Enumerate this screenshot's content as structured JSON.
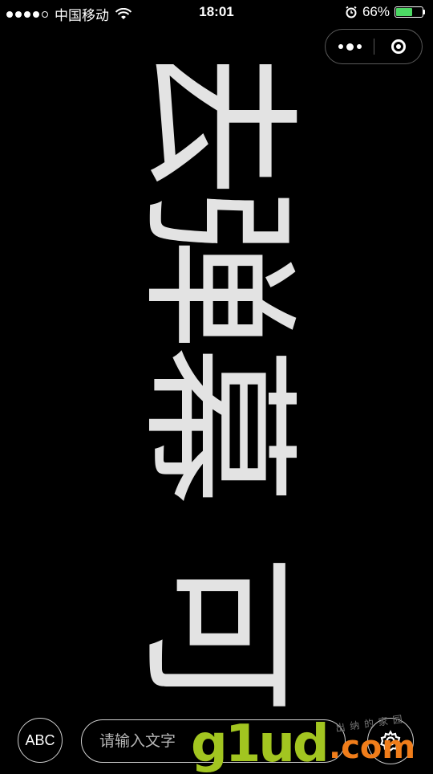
{
  "status_bar": {
    "carrier": "中国移动",
    "time": "18:01",
    "battery_percent": "66%",
    "battery_level": 0.66,
    "battery_color": "#4cd964"
  },
  "capsule": {
    "menu_icon": "more-dots-icon",
    "close_icon": "target-circle-icon"
  },
  "danmaku": {
    "chars": [
      "去",
      "弹",
      "幕",
      "可"
    ],
    "text_color": "#e3e3e3",
    "orientation": "rotated-90deg"
  },
  "toolbar": {
    "abc_label": "ABC",
    "input_placeholder": "请输入文字",
    "input_value": "",
    "settings_icon": "gear-icon"
  },
  "watermark": {
    "text": "g1ud",
    "domain": ".com",
    "subtext": "出纳的家园"
  }
}
